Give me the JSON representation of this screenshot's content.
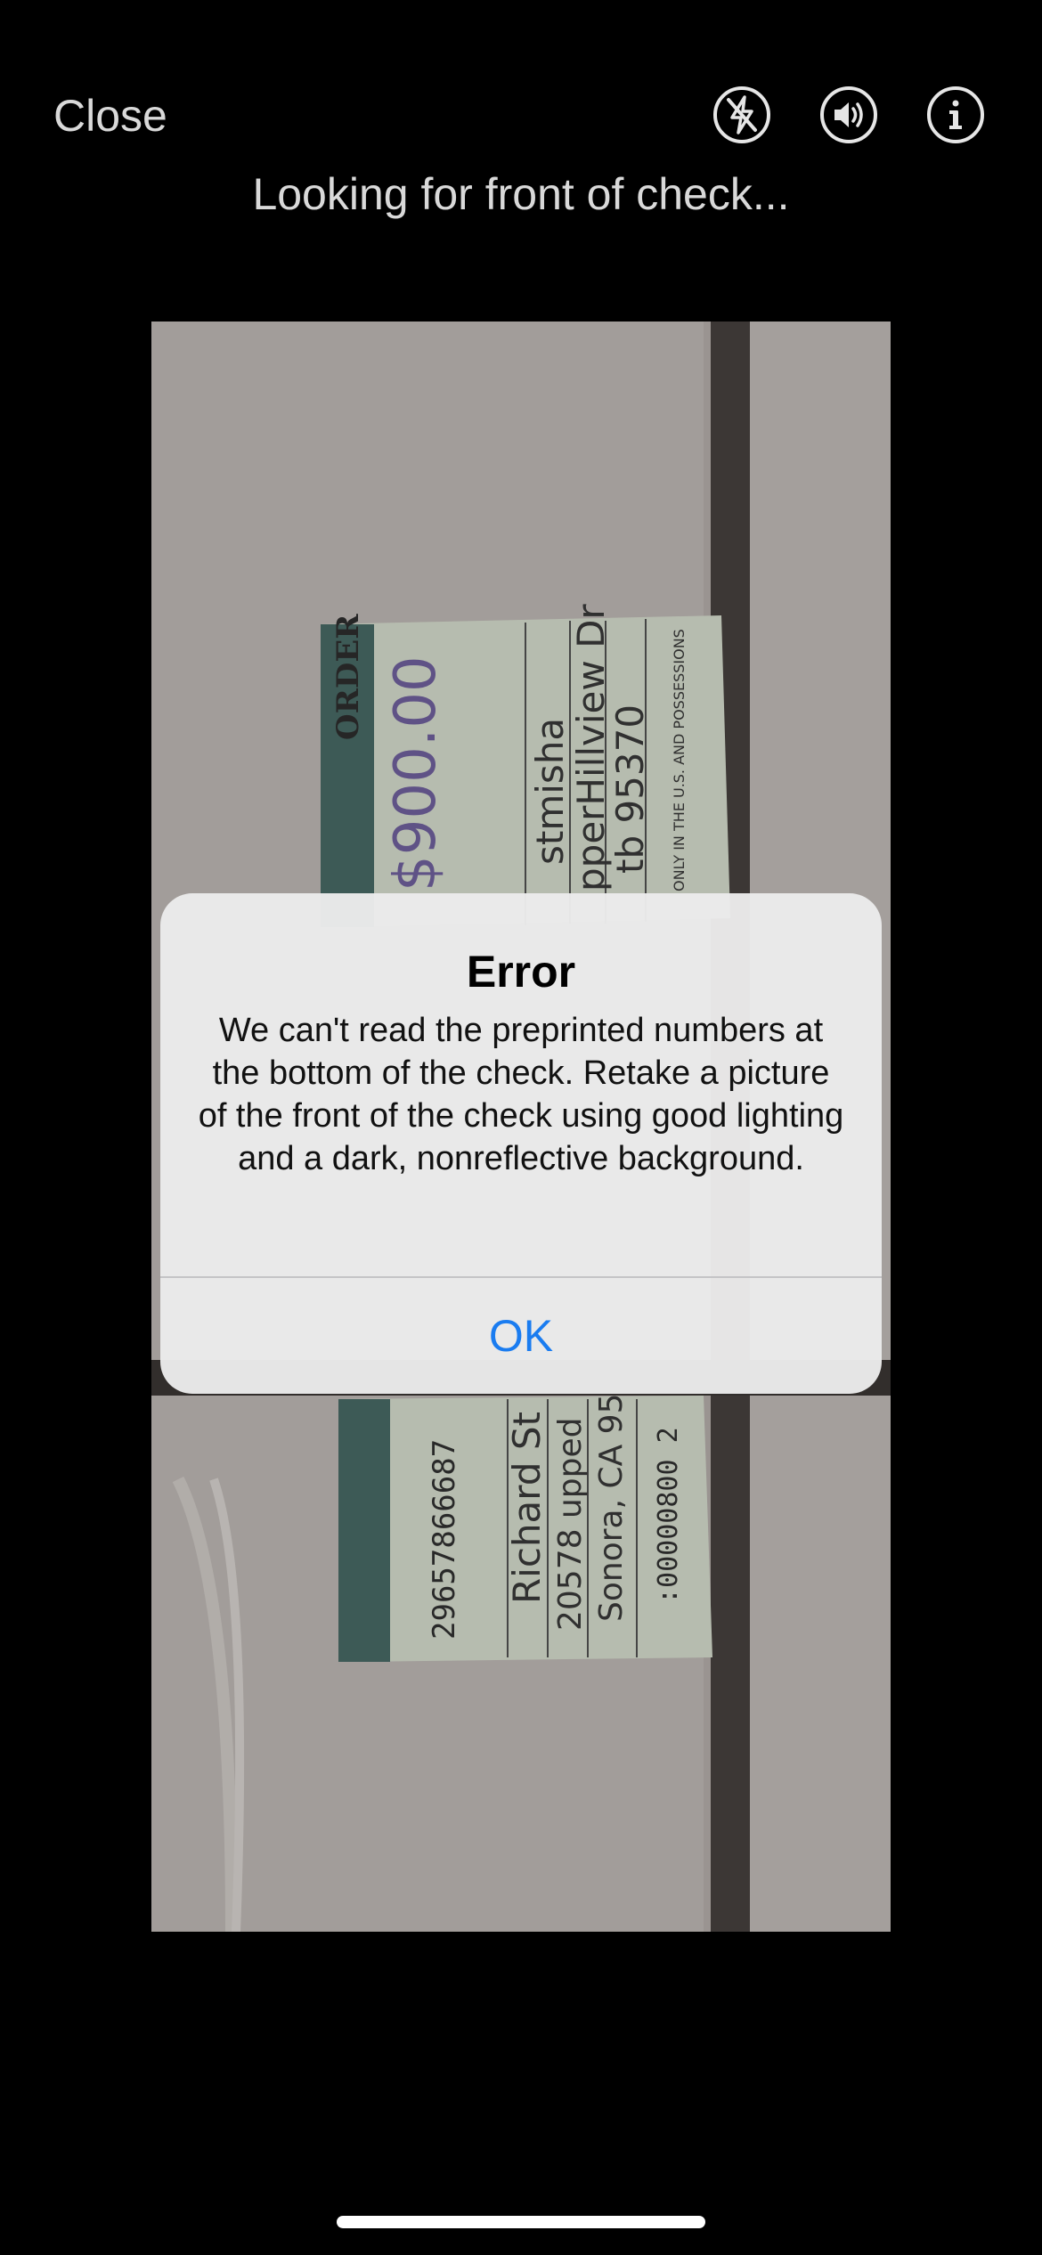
{
  "header": {
    "close_label": "Close",
    "status_text": "Looking for front of check..."
  },
  "toolbar": {
    "icons": [
      "flash-off-icon",
      "speaker-icon",
      "info-icon"
    ]
  },
  "alert": {
    "title": "Error",
    "message": "We can't read the preprinted numbers at the bottom of the check. Retake a picture of the front of the check using good lighting and a dark, nonreflective background.",
    "ok_label": "OK"
  },
  "colors": {
    "background": "#000000",
    "accent": "#1a7cf0",
    "alert_bg": "#ebebeb"
  }
}
